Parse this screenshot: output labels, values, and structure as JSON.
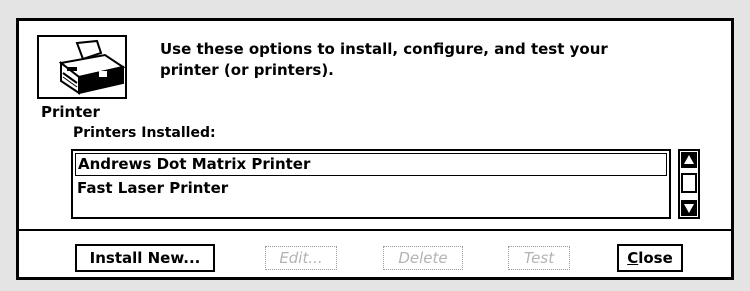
{
  "dialog": {
    "icon_label": "Printer",
    "instructions_line1": "Use these options to install, configure, and test your",
    "instructions_line2": "printer (or printers).",
    "list_label": "Printers Installed:",
    "printers": [
      {
        "name": "Andrews Dot Matrix Printer",
        "selected": true
      },
      {
        "name": "Fast Laser Printer",
        "selected": false
      }
    ],
    "scrollbar": {
      "up_icon": "arrow-up-icon",
      "down_icon": "arrow-down-icon"
    },
    "buttons": {
      "install": "Install New...",
      "edit": "Edit...",
      "delete": "Delete",
      "test": "Test",
      "close_first": "C",
      "close_rest": "lose"
    }
  },
  "colors": {
    "background": "#e4e4e4",
    "dialog": "#ffffff",
    "border": "#000000",
    "disabled_text": "#b3b3b3"
  }
}
